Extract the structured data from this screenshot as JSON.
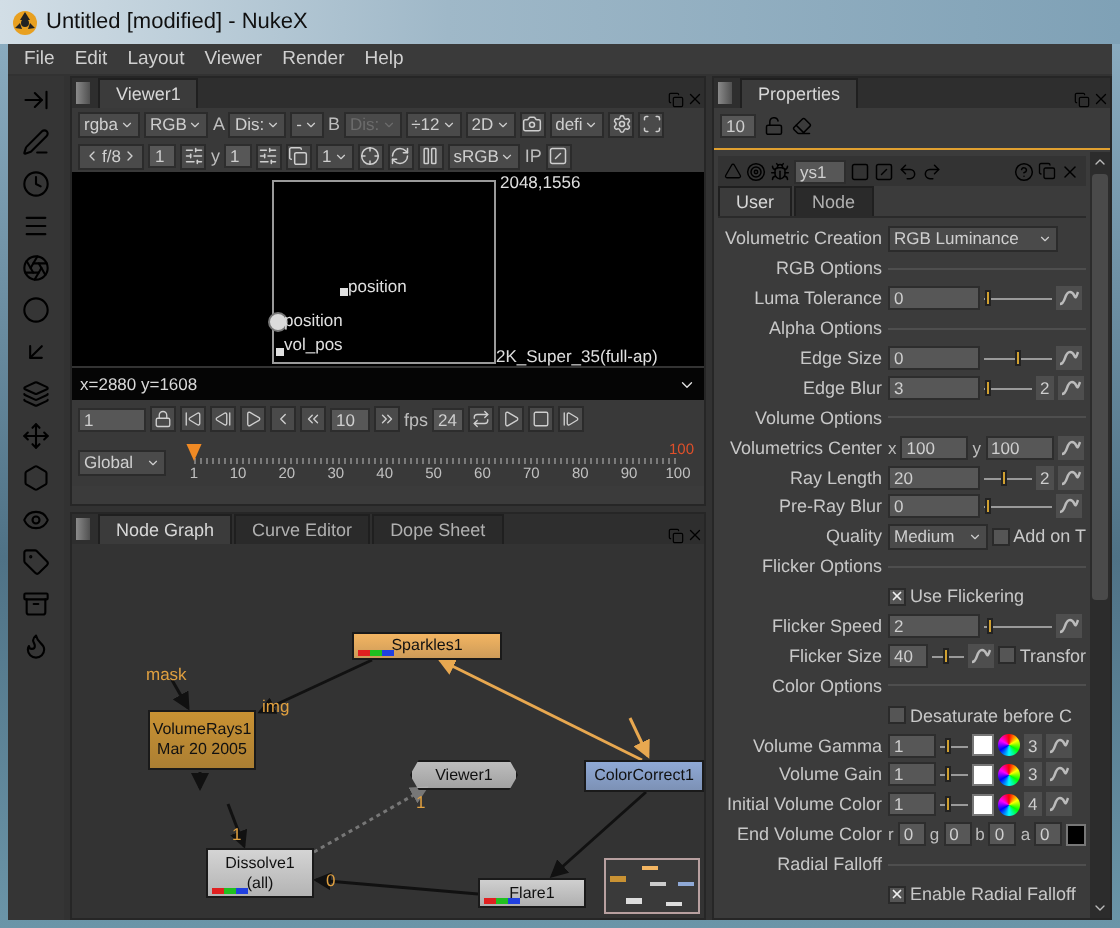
{
  "window": {
    "title": "Untitled [modified] - NukeX"
  },
  "menu": [
    "File",
    "Edit",
    "Layout",
    "Viewer",
    "Render",
    "Help"
  ],
  "viewer": {
    "tab": "Viewer1",
    "toolbar_1": [
      {
        "kind": "dropdown",
        "label": "rgba"
      },
      {
        "kind": "dropdown",
        "label": "RGB"
      },
      {
        "kind": "letter",
        "label": "A"
      },
      {
        "kind": "dropdown",
        "label": "Dis:"
      },
      {
        "kind": "dropdown",
        "label": "-"
      },
      {
        "kind": "letter",
        "label": "B"
      },
      {
        "kind": "dropdown",
        "label": "Dis:",
        "disabled": true
      },
      {
        "kind": "dropdown",
        "label": "÷12"
      },
      {
        "kind": "dropdown",
        "label": "2D"
      },
      {
        "kind": "icon"
      },
      {
        "kind": "dropdown",
        "label": "defi"
      },
      {
        "kind": "icon"
      },
      {
        "kind": "icon"
      }
    ],
    "toolbar_2": [
      {
        "kind": "stepper",
        "label": "f/8"
      },
      {
        "kind": "field",
        "label": "1"
      },
      {
        "kind": "icon"
      },
      {
        "kind": "letter",
        "label": "y"
      },
      {
        "kind": "field",
        "label": "1"
      },
      {
        "kind": "icon"
      },
      {
        "kind": "icon"
      },
      {
        "kind": "dropdown",
        "label": "1"
      },
      {
        "kind": "icon"
      },
      {
        "kind": "icon"
      },
      {
        "kind": "icon"
      },
      {
        "kind": "dropdown",
        "label": "sRGB"
      },
      {
        "kind": "letter",
        "label": "IP"
      },
      {
        "kind": "icon"
      }
    ],
    "canvas_labels": [
      "position",
      "position",
      "vol_pos"
    ],
    "format_corner": "2048,1556",
    "format_name": "2K_Super_35(full-ap)",
    "coordinates": "x=2880 y=1608",
    "transport": {
      "frame": "1",
      "increment": "10",
      "fps_label": "fps",
      "fps": "24"
    },
    "timeline": {
      "range": "Global",
      "ticks": [
        "1",
        "10",
        "20",
        "30",
        "40",
        "50",
        "60",
        "70",
        "80",
        "90",
        "100"
      ],
      "end_marker": "100",
      "level": 0
    }
  },
  "node_graph": {
    "tabs": [
      {
        "label": "Node Graph",
        "selected": true
      },
      {
        "label": "Curve Editor",
        "selected": false
      },
      {
        "label": "Dope Sheet",
        "selected": false
      }
    ],
    "nodes": [
      {
        "kind": "node",
        "label": "Sparkles1",
        "color": "#f3b562",
        "channels": true
      },
      {
        "kind": "node",
        "label": "VolumeRays1",
        "sublabel": "Mar 20 2005",
        "color": "#c99233",
        "channels": false
      },
      {
        "kind": "viewer",
        "label": "Viewer1",
        "color": "#bdbdbd",
        "channels": false
      },
      {
        "kind": "node",
        "label": "ColorCorrect1",
        "color": "#8fa9d6",
        "channels": false
      },
      {
        "kind": "node",
        "label": "Dissolve1",
        "sublabel": "(all)",
        "color": "#d4d4d4",
        "channels": true
      },
      {
        "kind": "node",
        "label": "Flare1",
        "color": "#cfcfcf",
        "channels": true
      }
    ],
    "edge_labels": [
      "mask",
      "img",
      "1",
      "1",
      "0"
    ]
  },
  "properties": {
    "tab": "Properties",
    "max_panels": "10",
    "node_name": "ys1",
    "tabs": [
      {
        "label": "User",
        "selected": true
      },
      {
        "label": "Node",
        "selected": false
      }
    ],
    "rows": [
      {
        "kind": "dropdown",
        "label": "Volumetric Creation",
        "value": "RGB Luminance"
      },
      {
        "kind": "section",
        "label": "RGB Options"
      },
      {
        "kind": "slider",
        "label": "Luma Tolerance",
        "value": "0",
        "level": 0
      },
      {
        "kind": "section",
        "label": "Alpha Options"
      },
      {
        "kind": "slider",
        "label": "Edge Size",
        "value": "0",
        "level": 0.5
      },
      {
        "kind": "slider",
        "label": "Edge Blur",
        "value": "3",
        "level": 0.1,
        "badge": "2"
      },
      {
        "kind": "section",
        "label": "Volume Options"
      },
      {
        "kind": "multi",
        "label": "Volumetrics Center",
        "fields": [
          {
            "prefix": "x",
            "value": "100"
          },
          {
            "prefix": "y",
            "value": "100"
          }
        ],
        "swatch": false
      },
      {
        "kind": "slider",
        "label": "Ray Length",
        "value": "20",
        "level": 0.4,
        "badge": "2"
      },
      {
        "kind": "slider",
        "label": "Pre-Ray Blur",
        "value": "0",
        "level": 0
      },
      {
        "kind": "dropdown",
        "label": "Quality",
        "value": "Medium",
        "check": {
          "label": "Add on T",
          "checked": false
        }
      },
      {
        "kind": "section",
        "label": "Flicker Options"
      },
      {
        "kind": "checkbox",
        "label": "Use Flickering",
        "checked": true
      },
      {
        "kind": "slider",
        "label": "Flicker Speed",
        "value": "2",
        "level": 0.1
      },
      {
        "kind": "slider",
        "label": "Flicker Size",
        "value": "40",
        "level": 0.4,
        "check": {
          "label": "Transfor",
          "checked": false
        }
      },
      {
        "kind": "section",
        "label": "Color Options"
      },
      {
        "kind": "checkbox",
        "label": "Desaturate before C",
        "checked": false
      },
      {
        "kind": "color",
        "label": "Volume Gamma",
        "value": "1",
        "level": 0.3,
        "badge": "3"
      },
      {
        "kind": "color",
        "label": "Volume Gain",
        "value": "1",
        "level": 0.3,
        "badge": "3"
      },
      {
        "kind": "color",
        "label": "Initial Volume Color",
        "value": "1",
        "level": 0.3,
        "badge": "4"
      },
      {
        "kind": "multi",
        "label": "End Volume Color",
        "fields": [
          {
            "prefix": "r",
            "value": "0"
          },
          {
            "prefix": "g",
            "value": "0"
          },
          {
            "prefix": "b",
            "value": "0"
          },
          {
            "prefix": "a",
            "value": "0"
          }
        ],
        "swatch": true
      },
      {
        "kind": "section",
        "label": "Radial Falloff"
      },
      {
        "kind": "checkbox",
        "label": "Enable Radial Falloff",
        "checked": true
      }
    ]
  }
}
